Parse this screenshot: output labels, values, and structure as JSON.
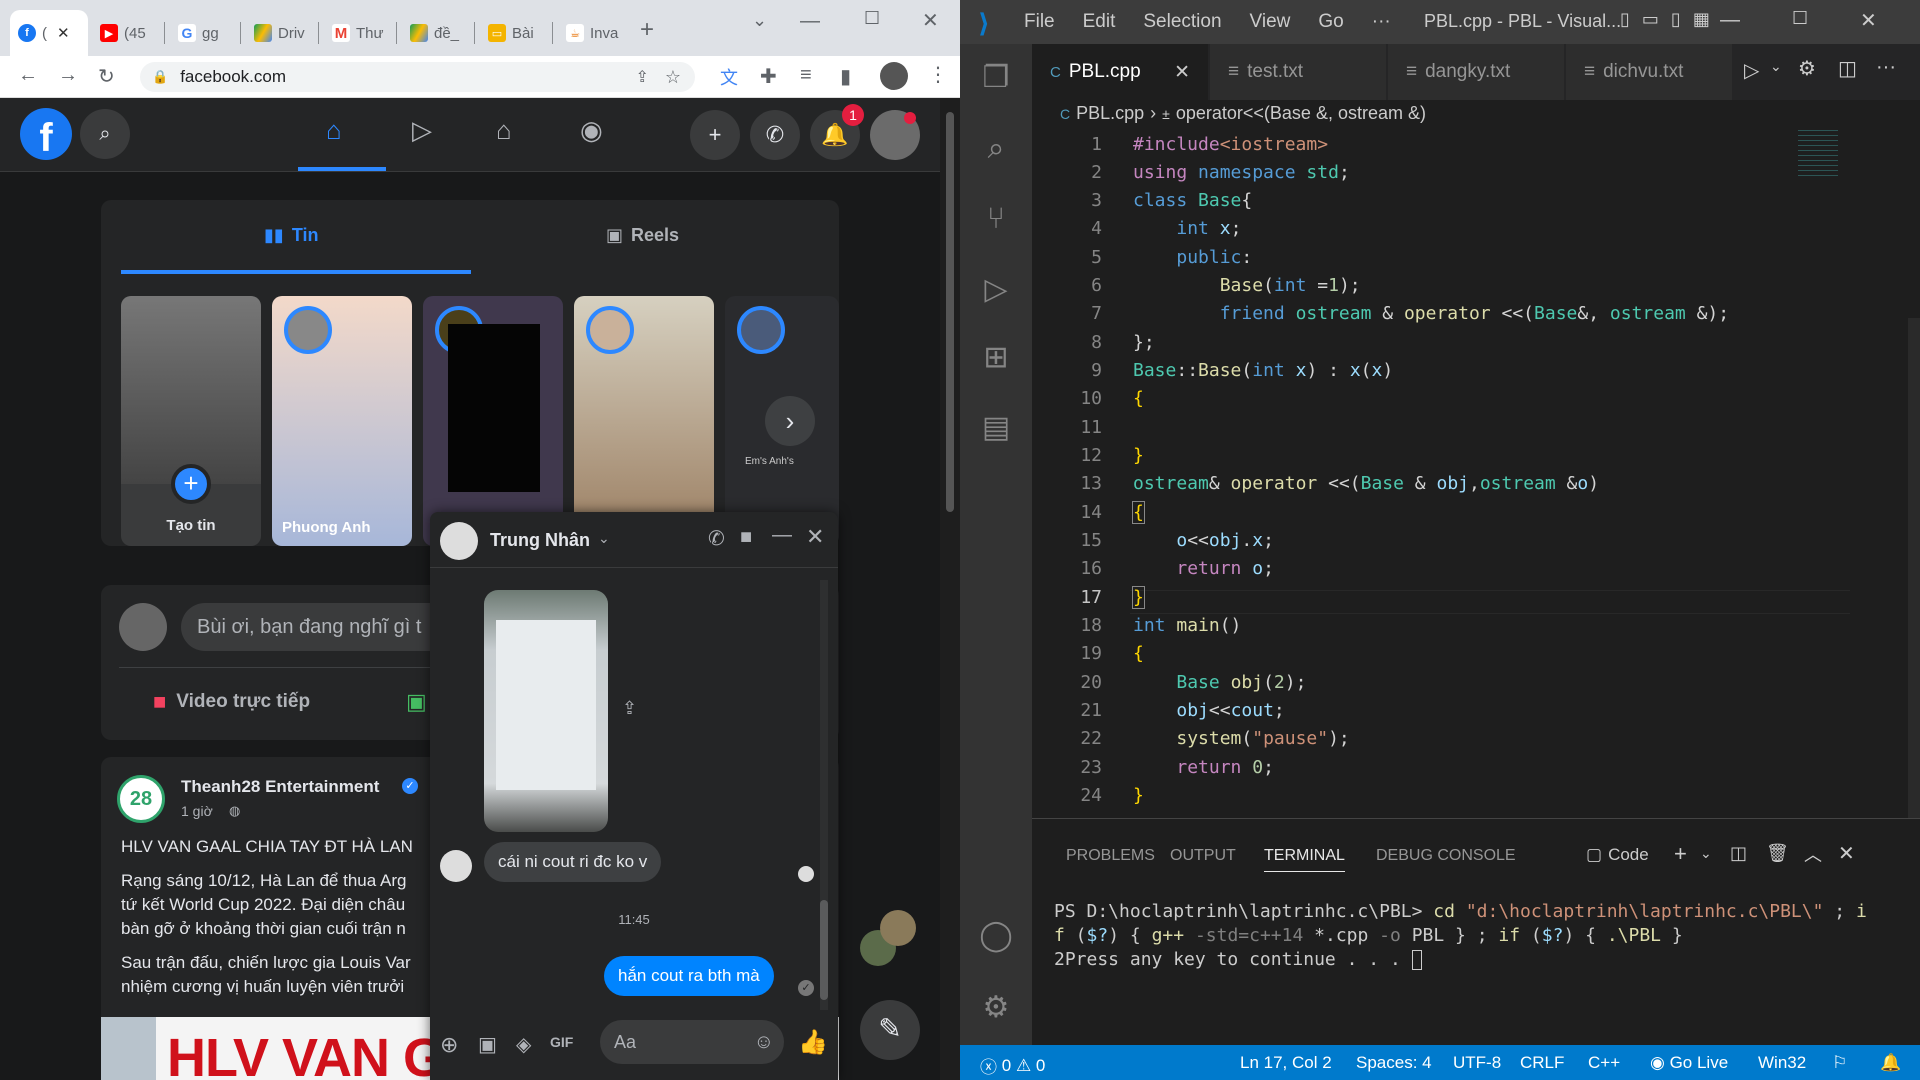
{
  "browser": {
    "tabs": [
      {
        "label": "(",
        "icon": "facebook-icon"
      },
      {
        "label": "(45",
        "icon": "youtube-icon"
      },
      {
        "label": "gg",
        "icon": "google-icon"
      },
      {
        "label": "Driv",
        "icon": "drive-icon"
      },
      {
        "label": "Thư",
        "icon": "gmail-icon"
      },
      {
        "label": "đề_",
        "icon": "drive-icon"
      },
      {
        "label": "Bài",
        "icon": "slides-icon"
      },
      {
        "label": "Inva",
        "icon": "java-icon"
      }
    ],
    "url": "facebook.com"
  },
  "facebook": {
    "notif_count": "1",
    "stories_tab": "Tin",
    "reels_tab": "Reels",
    "stories": [
      {
        "name": "Tạo tin"
      },
      {
        "name": "Phuong Anh"
      },
      {
        "name": ""
      },
      {
        "name": ""
      },
      {
        "name": "Em's Anh's"
      }
    ],
    "composer_placeholder": "Bùi ơi, bạn đang nghĩ gì t",
    "live_video": "Video trực tiếp",
    "post": {
      "author": "Theanh28 Entertainment",
      "time": "1 giờ",
      "headline": "HLV VAN GAAL CHIA TAY ĐT HÀ LAN",
      "body": [
        "Rạng sáng 10/12, Hà Lan để thua Arg",
        "tứ kết World Cup 2022. Đại diện châu",
        "bàn gỡ ở khoảng thời gian cuối trận n"
      ],
      "body2": [
        "Sau trận đấu, chiến lược gia Louis Var",
        "nhiệm cương vị huấn luyện viên trưởi"
      ],
      "image_text": "HLV VAN GAA"
    }
  },
  "messenger": {
    "contact": "Trung Nhân",
    "incoming": "cái ni cout ri đc ko v",
    "time": "11:45",
    "outgoing": "hắn cout ra bth mà",
    "input_placeholder": "Aa"
  },
  "vscode": {
    "title": "PBL.cpp - PBL - Visual...",
    "menu": [
      "File",
      "Edit",
      "Selection",
      "View",
      "Go",
      "···"
    ],
    "tabs": [
      "PBL.cpp",
      "test.txt",
      "dangky.txt",
      "dichvu.txt"
    ],
    "breadcrumb_file": "PBL.cpp",
    "breadcrumb_symbol": "operator<<(Base &, ostream &)",
    "line_numbers": [
      "1",
      "2",
      "3",
      "4",
      "5",
      "6",
      "7",
      "8",
      "9",
      "10",
      "11",
      "12",
      "13",
      "14",
      "15",
      "16",
      "17",
      "18",
      "19",
      "20",
      "21",
      "22",
      "23",
      "24"
    ],
    "panel_tabs": [
      "PROBLEMS",
      "OUTPUT",
      "TERMINAL",
      "DEBUG CONSOLE"
    ],
    "terminal_profile": "Code",
    "terminal_lines": [
      "PS D:\\hoclaptrinh\\laptrinhc.c\\PBL> cd \"d:\\hoclaptrinh\\laptrinhc.c\\PBL\\\" ; i",
      "f ($?) { g++ -std=c++14 *.cpp -o PBL } ; if ($?) { .\\PBL }",
      "2Press any key to continue . . . "
    ],
    "status": {
      "errors": "0",
      "warnings": "0",
      "position": "Ln 17, Col 2",
      "spaces": "Spaces: 4",
      "encoding": "UTF-8",
      "eol": "CRLF",
      "language": "C++",
      "golive": "Go Live",
      "platform": "Win32"
    }
  }
}
